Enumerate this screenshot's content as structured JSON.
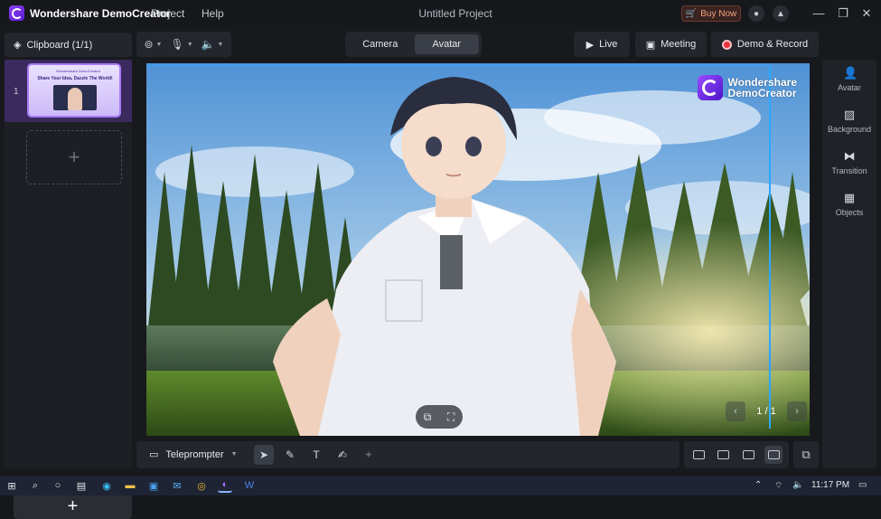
{
  "titlebar": {
    "app_name": "Wondershare DemoCreator",
    "menu": [
      "Project",
      "Help"
    ],
    "document_title": "Untitled Project",
    "buy_now": "Buy Now",
    "icons": [
      "user-icon",
      "graduation-icon"
    ],
    "window_controls": [
      "minimize",
      "restore",
      "close"
    ]
  },
  "left_panel": {
    "header": "Clipboard (1/1)",
    "clips": [
      {
        "index": "1",
        "thumb_brand": "Wondershare DemoCreator",
        "thumb_title": "Share Your Idea, Dazzle The World!"
      }
    ],
    "add_symbol": "+",
    "add_button_symbol": "+"
  },
  "device_bar": {
    "webcam": "webcam-icon",
    "mic": "microphone-icon",
    "speaker": "speaker-icon"
  },
  "mode_tabs": [
    {
      "label": "Camera",
      "active": false
    },
    {
      "label": "Avatar",
      "active": true
    }
  ],
  "actions": {
    "live": "Live",
    "meeting": "Meeting",
    "demo_record": "Demo & Record"
  },
  "canvas": {
    "watermark_line1": "Wondershare",
    "watermark_line2": "DemoCreator",
    "pager": "1 / 1",
    "pager_prev": "‹",
    "pager_next": "›"
  },
  "right_panel": {
    "items": [
      "Avatar",
      "Background",
      "Transition",
      "Objects"
    ]
  },
  "bottom_bar": {
    "teleprompter": "Teleprompter"
  },
  "taskbar": {
    "time": "11:17 PM"
  },
  "colors": {
    "accent_purple": "#7c3aed",
    "record_red": "#e8323c",
    "selection_blue": "#2aa7ff"
  }
}
